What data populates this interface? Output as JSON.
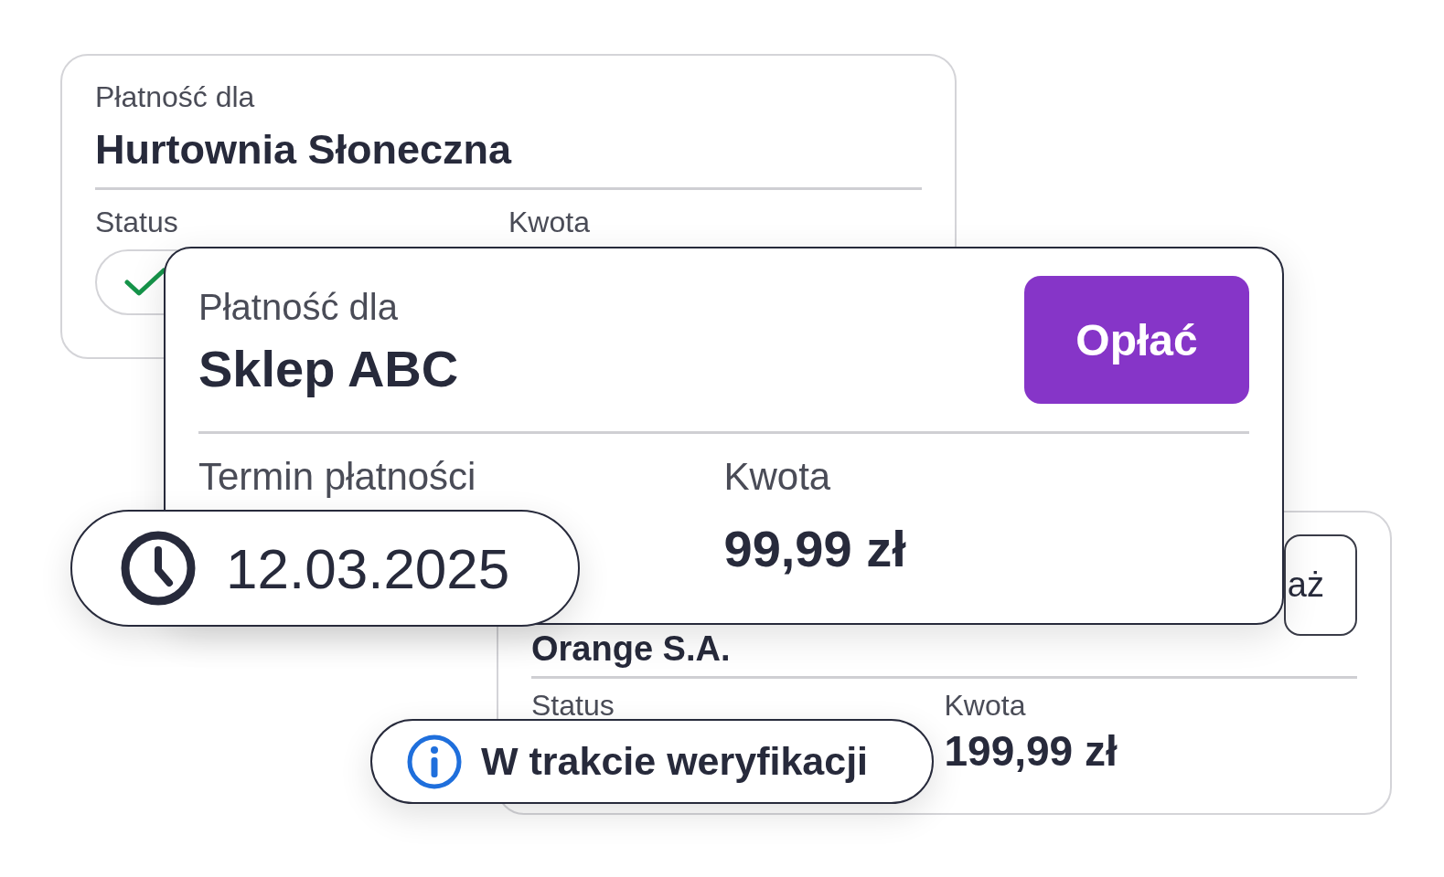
{
  "back_card_top": {
    "label": "Płatność dla",
    "payee": "Hurtownia Słoneczna",
    "fields": [
      {
        "label": "Status"
      },
      {
        "label": "Kwota"
      }
    ],
    "status_badge": {
      "kind": "success"
    }
  },
  "back_card_bottom": {
    "payee": "Orange S.A.",
    "button": "aż",
    "fields": [
      {
        "label": "Status"
      },
      {
        "label": "Kwota",
        "value": "199,99 zł"
      }
    ]
  },
  "main_card": {
    "label": "Płatność dla",
    "payee": "Sklep ABC",
    "button": "Opłać",
    "fields": [
      {
        "label": "Termin płatności"
      },
      {
        "label": "Kwota",
        "value": "99,99 zł"
      }
    ]
  },
  "date_badge": {
    "kind": "clock",
    "text": "12.03.2025"
  },
  "status_badge": {
    "kind": "info",
    "text": "W trakcie weryfikacji"
  }
}
